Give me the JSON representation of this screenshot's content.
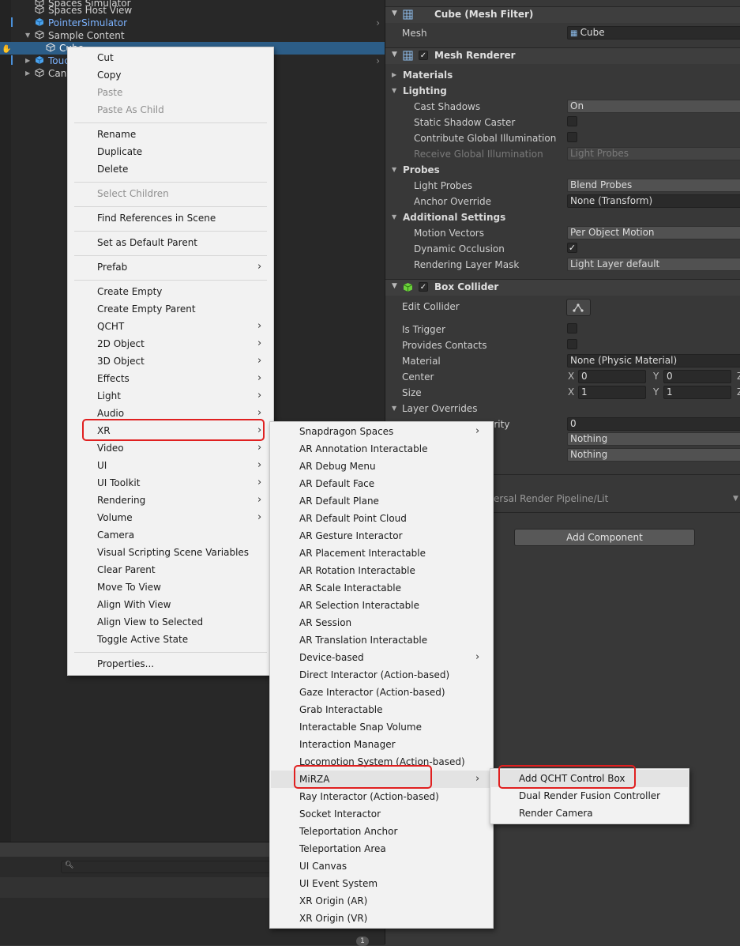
{
  "hierarchy": {
    "rows": [
      {
        "label": "Spaces Simulator",
        "depth": 1,
        "prefab": false
      },
      {
        "label": "Spaces Host View",
        "depth": 1,
        "prefab": false
      },
      {
        "label": "PointerSimulator",
        "depth": 1,
        "prefab": true
      },
      {
        "label": "Sample Content",
        "depth": 0,
        "prefab": false
      },
      {
        "label": "Cube",
        "depth": 1,
        "prefab": false
      },
      {
        "label": "Touch",
        "depth": 0,
        "prefab": true
      },
      {
        "label": "Canvas",
        "depth": 0,
        "prefab": false
      }
    ],
    "console_count": "1"
  },
  "inspector": {
    "mesh_filter": {
      "title": "Cube (Mesh Filter)",
      "mesh_label": "Mesh",
      "mesh_value": "Cube"
    },
    "mesh_renderer": {
      "title": "Mesh Renderer",
      "enabled": true,
      "materials": "Materials",
      "lighting": "Lighting",
      "cast_shadows_label": "Cast Shadows",
      "cast_shadows": "On",
      "static_shadow_label": "Static Shadow Caster",
      "contribute_gi_label": "Contribute Global Illumination",
      "receive_gi_label": "Receive Global Illumination",
      "receive_gi": "Light Probes",
      "probes": "Probes",
      "light_probes_label": "Light Probes",
      "light_probes": "Blend Probes",
      "anchor_override_label": "Anchor Override",
      "anchor_override": "None (Transform)",
      "additional": "Additional Settings",
      "motion_vectors_label": "Motion Vectors",
      "motion_vectors": "Per Object Motion",
      "dynamic_occlusion_label": "Dynamic Occlusion",
      "render_layer_label": "Rendering Layer Mask",
      "render_layer": "Light Layer default"
    },
    "box_collider": {
      "title": "Box Collider",
      "enabled": true,
      "edit_collider_label": "Edit Collider",
      "is_trigger_label": "Is Trigger",
      "provides_contacts_label": "Provides Contacts",
      "material_label": "Material",
      "material": "None (Physic Material)",
      "center_label": "Center",
      "center_x": "0",
      "center_y": "0",
      "size_label": "Size",
      "size_x": "1",
      "size_y": "1",
      "layer_overrides": "Layer Overrides",
      "priority_partial": "ority",
      "priority": "0",
      "include": "Nothing",
      "exclude": "Nothing"
    },
    "material_shader_partial": "ersal Render Pipeline/Lit",
    "add_component": "Add Component"
  },
  "context_menu": {
    "items": [
      {
        "label": "Cut",
        "disabled": false,
        "sub": false
      },
      {
        "label": "Copy",
        "disabled": false,
        "sub": false
      },
      {
        "label": "Paste",
        "disabled": true,
        "sub": false
      },
      {
        "label": "Paste As Child",
        "disabled": true,
        "sub": false
      },
      {
        "label": "Rename",
        "disabled": false,
        "sub": false
      },
      {
        "label": "Duplicate",
        "disabled": false,
        "sub": false
      },
      {
        "label": "Delete",
        "disabled": false,
        "sub": false
      },
      {
        "label": "Select Children",
        "disabled": true,
        "sub": false
      },
      {
        "label": "Find References in Scene",
        "disabled": false,
        "sub": false
      },
      {
        "label": "Set as Default Parent",
        "disabled": false,
        "sub": false
      },
      {
        "label": "Prefab",
        "disabled": false,
        "sub": true
      },
      {
        "label": "Create Empty",
        "disabled": false,
        "sub": false
      },
      {
        "label": "Create Empty Parent",
        "disabled": false,
        "sub": false
      },
      {
        "label": "QCHT",
        "disabled": false,
        "sub": true
      },
      {
        "label": "2D Object",
        "disabled": false,
        "sub": true
      },
      {
        "label": "3D Object",
        "disabled": false,
        "sub": true
      },
      {
        "label": "Effects",
        "disabled": false,
        "sub": true
      },
      {
        "label": "Light",
        "disabled": false,
        "sub": true
      },
      {
        "label": "Audio",
        "disabled": false,
        "sub": true
      },
      {
        "label": "XR",
        "disabled": false,
        "sub": true
      },
      {
        "label": "Video",
        "disabled": false,
        "sub": true
      },
      {
        "label": "UI",
        "disabled": false,
        "sub": true
      },
      {
        "label": "UI Toolkit",
        "disabled": false,
        "sub": true
      },
      {
        "label": "Rendering",
        "disabled": false,
        "sub": true
      },
      {
        "label": "Volume",
        "disabled": false,
        "sub": true
      },
      {
        "label": "Camera",
        "disabled": false,
        "sub": false
      },
      {
        "label": "Visual Scripting Scene Variables",
        "disabled": false,
        "sub": false
      },
      {
        "label": "Clear Parent",
        "disabled": false,
        "sub": false
      },
      {
        "label": "Move To View",
        "disabled": false,
        "sub": false
      },
      {
        "label": "Align With View",
        "disabled": false,
        "sub": false
      },
      {
        "label": "Align View to Selected",
        "disabled": false,
        "sub": false
      },
      {
        "label": "Toggle Active State",
        "disabled": false,
        "sub": false
      },
      {
        "label": "Properties...",
        "disabled": false,
        "sub": false
      }
    ]
  },
  "xr_menu": {
    "items": [
      {
        "label": "Snapdragon Spaces",
        "sub": true
      },
      {
        "label": "AR Annotation Interactable",
        "sub": false
      },
      {
        "label": "AR Debug Menu",
        "sub": false
      },
      {
        "label": "AR Default Face",
        "sub": false
      },
      {
        "label": "AR Default Plane",
        "sub": false
      },
      {
        "label": "AR Default Point Cloud",
        "sub": false
      },
      {
        "label": "AR Gesture Interactor",
        "sub": false
      },
      {
        "label": "AR Placement Interactable",
        "sub": false
      },
      {
        "label": "AR Rotation Interactable",
        "sub": false
      },
      {
        "label": "AR Scale Interactable",
        "sub": false
      },
      {
        "label": "AR Selection Interactable",
        "sub": false
      },
      {
        "label": "AR Session",
        "sub": false
      },
      {
        "label": "AR Translation Interactable",
        "sub": false
      },
      {
        "label": "Device-based",
        "sub": true
      },
      {
        "label": "Direct Interactor (Action-based)",
        "sub": false
      },
      {
        "label": "Gaze Interactor (Action-based)",
        "sub": false
      },
      {
        "label": "Grab Interactable",
        "sub": false
      },
      {
        "label": "Interactable Snap Volume",
        "sub": false
      },
      {
        "label": "Interaction Manager",
        "sub": false
      },
      {
        "label": "Locomotion System (Action-based)",
        "sub": false
      },
      {
        "label": "MiRZA",
        "sub": true
      },
      {
        "label": "Ray Interactor (Action-based)",
        "sub": false
      },
      {
        "label": "Socket Interactor",
        "sub": false
      },
      {
        "label": "Teleportation Anchor",
        "sub": false
      },
      {
        "label": "Teleportation Area",
        "sub": false
      },
      {
        "label": "UI Canvas",
        "sub": false
      },
      {
        "label": "UI Event System",
        "sub": false
      },
      {
        "label": "XR Origin (AR)",
        "sub": false
      },
      {
        "label": "XR Origin (VR)",
        "sub": false
      }
    ]
  },
  "mirza_menu": {
    "items": [
      {
        "label": "Add QCHT Control Box"
      },
      {
        "label": "Dual Render Fusion Controller"
      },
      {
        "label": "Render Camera"
      }
    ]
  },
  "colors": {
    "highlight_box": "#e02020",
    "selection": "#2c5d87",
    "prefab_text": "#7cb3ff"
  }
}
